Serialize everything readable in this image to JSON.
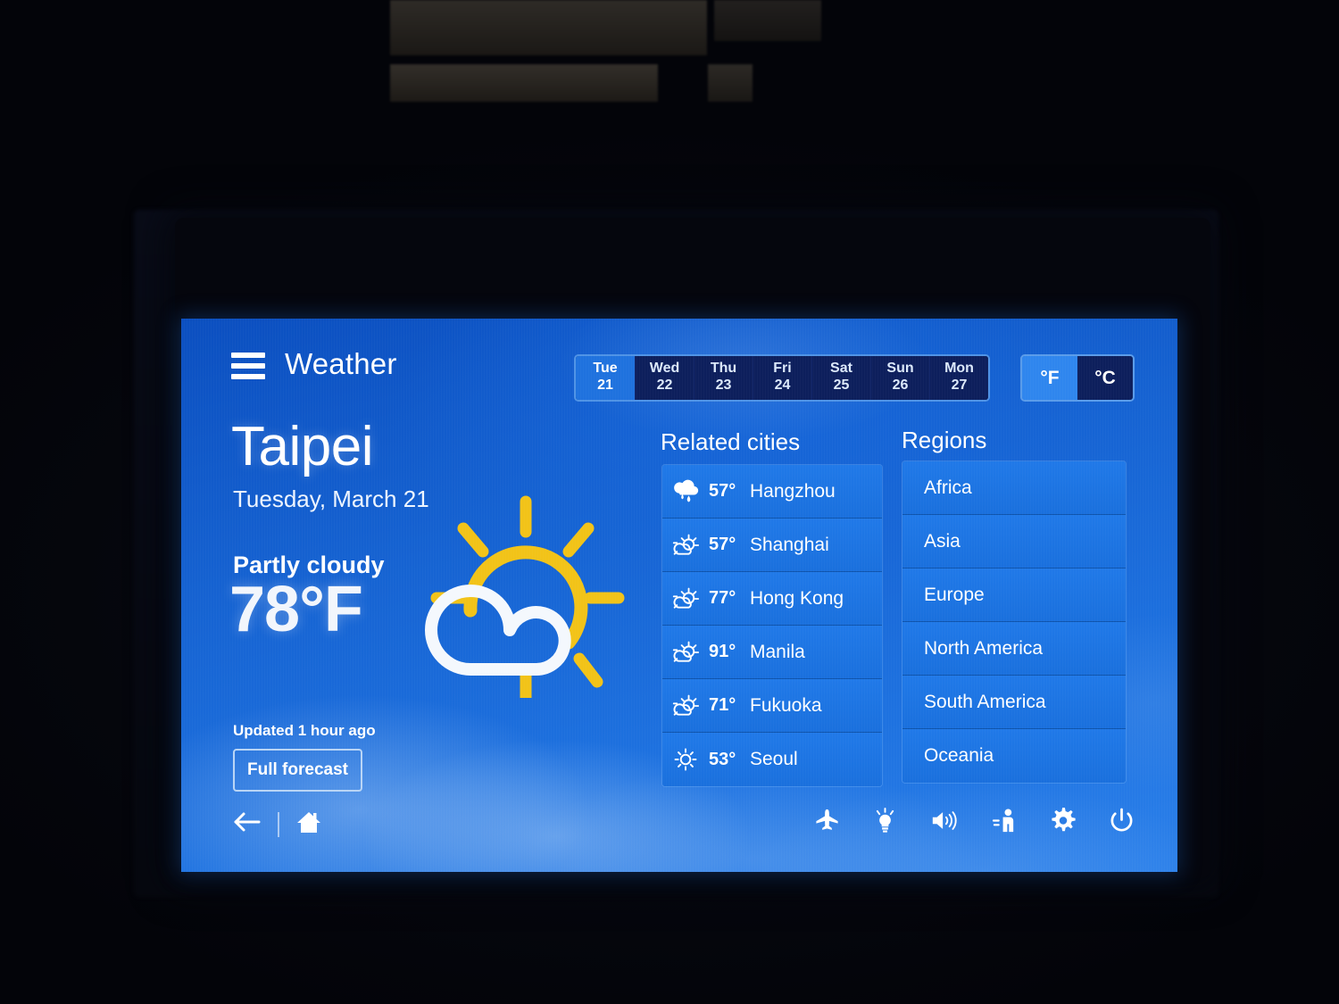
{
  "device": {
    "context": "in-flight entertainment seatback screen in dark cabin"
  },
  "header": {
    "menu_icon": "hamburger-menu-icon",
    "title": "Weather",
    "days": [
      {
        "dow": "Tue",
        "num": "21",
        "active": true
      },
      {
        "dow": "Wed",
        "num": "22",
        "active": false
      },
      {
        "dow": "Thu",
        "num": "23",
        "active": false
      },
      {
        "dow": "Fri",
        "num": "24",
        "active": false
      },
      {
        "dow": "Sat",
        "num": "25",
        "active": false
      },
      {
        "dow": "Sun",
        "num": "26",
        "active": false
      },
      {
        "dow": "Mon",
        "num": "27",
        "active": false
      }
    ],
    "units": {
      "fahrenheit": "°F",
      "celsius": "°C",
      "selected": "°F"
    }
  },
  "current": {
    "city": "Taipei",
    "date": "Tuesday, March 21",
    "condition": "Partly cloudy",
    "temperature": "78°F",
    "icon": "sun-behind-cloud-icon",
    "updated": "Updated 1 hour ago",
    "full_forecast_label": "Full forecast"
  },
  "related_cities": {
    "title": "Related cities",
    "items": [
      {
        "temp": "57°",
        "name": "Hangzhou",
        "icon": "rain-cloud-icon"
      },
      {
        "temp": "57°",
        "name": "Shanghai",
        "icon": "sun-behind-cloud-icon"
      },
      {
        "temp": "77°",
        "name": "Hong Kong",
        "icon": "sun-behind-cloud-icon"
      },
      {
        "temp": "91°",
        "name": "Manila",
        "icon": "sun-behind-cloud-icon"
      },
      {
        "temp": "71°",
        "name": "Fukuoka",
        "icon": "sun-behind-cloud-icon"
      },
      {
        "temp": "53°",
        "name": "Seoul",
        "icon": "sun-icon"
      }
    ]
  },
  "regions": {
    "title": "Regions",
    "items": [
      {
        "name": "Africa"
      },
      {
        "name": "Asia"
      },
      {
        "name": "Europe"
      },
      {
        "name": "North America"
      },
      {
        "name": "South America"
      },
      {
        "name": "Oceania"
      }
    ]
  },
  "nav": {
    "back_icon": "back-arrow-icon",
    "home_icon": "home-icon"
  },
  "system_bar": {
    "icons": [
      "airplane-icon",
      "reading-light-icon",
      "volume-icon",
      "flight-attendant-call-icon",
      "settings-gear-icon",
      "power-icon"
    ]
  },
  "colors": {
    "screen_blue": "#1663d2",
    "row_blue": "#2079e8",
    "active_day": "#1f72de",
    "inactive_day": "#0d1f5c",
    "sun_yellow": "#f2c318",
    "text_white": "#ffffff"
  }
}
